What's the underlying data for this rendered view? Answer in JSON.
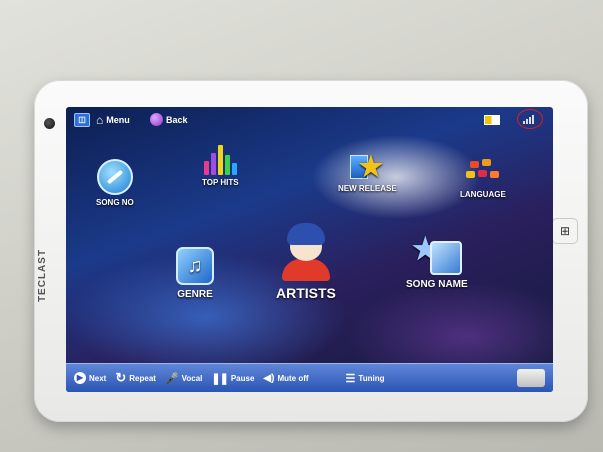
{
  "device": {
    "brand": "TECLAST"
  },
  "topbar": {
    "menu_label": "Menu",
    "back_label": "Back"
  },
  "tiles": {
    "song_no": "SONG NO",
    "top_hits": "TOP HITS",
    "new_release": "NEW RELEASE",
    "language": "LANGUAGE",
    "genre": "GENRE",
    "artists": "ARTISTS",
    "song_name": "SONG NAME"
  },
  "bottombar": {
    "next": "Next",
    "repeat": "Repeat",
    "vocal": "Vocal",
    "pause": "Pause",
    "mute": "Mute off",
    "tuning": "Tuning",
    "accompaniment": ""
  },
  "colors": {
    "highlight_circle": "#e01b1b",
    "bottom_bar": "#2b55b5"
  }
}
